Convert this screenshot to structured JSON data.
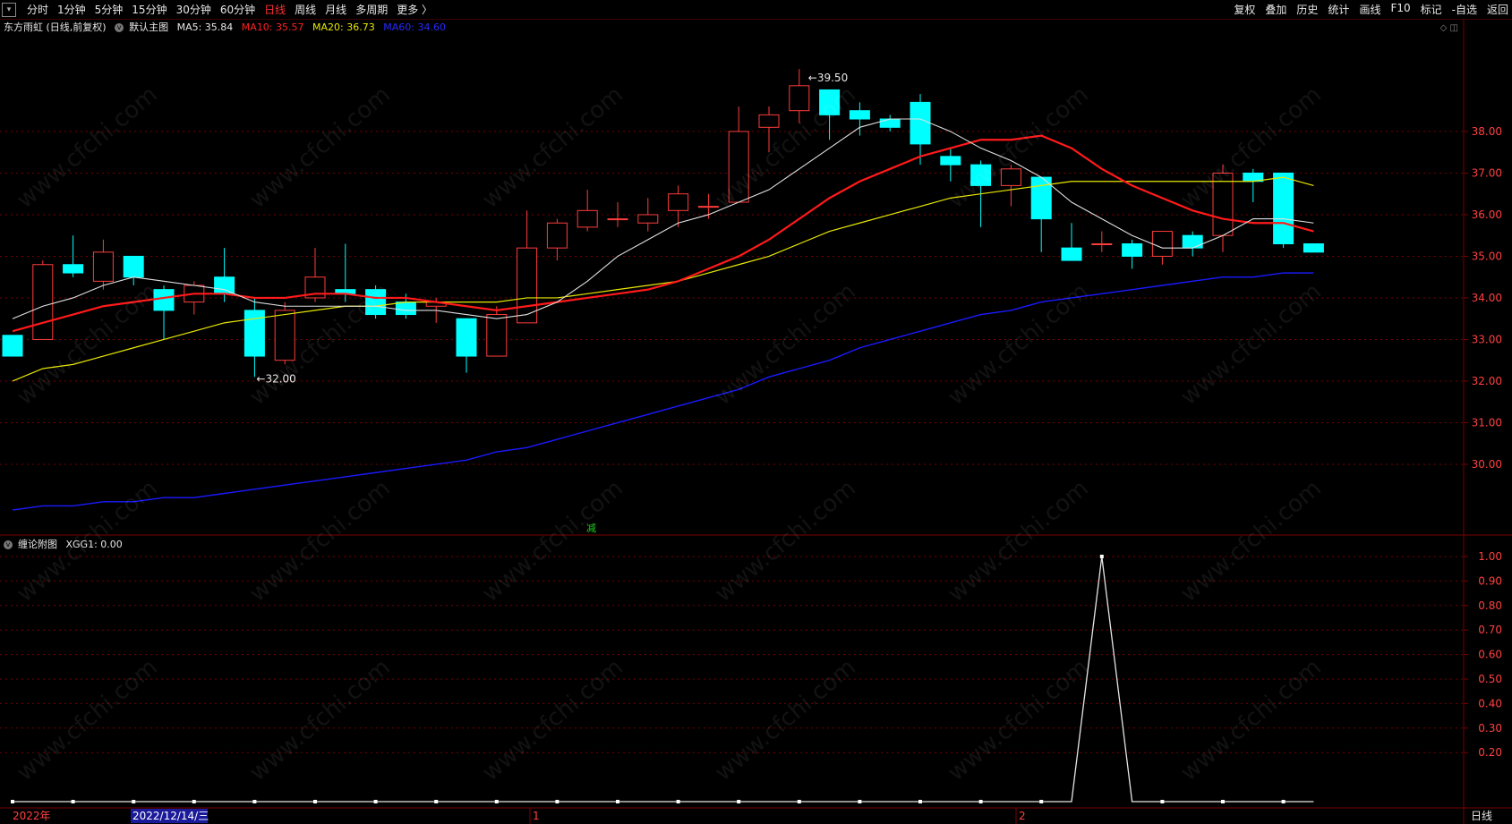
{
  "toolbar": {
    "periods": [
      "分时",
      "1分钟",
      "5分钟",
      "15分钟",
      "30分钟",
      "60分钟",
      "日线",
      "周线",
      "月线",
      "多周期",
      "更多 〉"
    ],
    "active_period": "日线",
    "right_buttons": [
      "复权",
      "叠加",
      "历史",
      "统计",
      "画线",
      "F10",
      "标记",
      "-自选",
      "返回"
    ]
  },
  "info": {
    "stock": "东方雨虹 (日线,前复权)",
    "indicator": "默认主图",
    "ma5": "MA5: 35.84",
    "ma10": "MA10: 35.57",
    "ma20": "MA20: 36.73",
    "ma60": "MA60: 34.60"
  },
  "sub_info": {
    "indicator": "缠论附图",
    "value": "XGG1: 0.00"
  },
  "colors": {
    "up": "#ff3c3c",
    "down": "#00ffff",
    "ma5": "#e0e0e0",
    "ma10": "#ff1a1a",
    "ma20": "#e8e800",
    "ma60": "#1a1aff",
    "grid": "#7a0000",
    "axis_text": "#ff4040"
  },
  "chart_data": [
    {
      "type": "candlestick",
      "y_ticks": [
        "38.00",
        "37.00",
        "36.00",
        "35.00",
        "34.00",
        "33.00",
        "32.00",
        "31.00",
        "30.00"
      ],
      "ylim": [
        28.3,
        40.3
      ],
      "annotations": {
        "high_label": "39.50",
        "low_label": "32.00",
        "marker": "减"
      },
      "x_labels": [
        "2022年",
        "2022/12/14/三",
        "1",
        "2"
      ],
      "bottom_right_label": "日线",
      "candles": [
        {
          "o": 33.1,
          "c": 32.6,
          "h": 33.1,
          "l": 32.6
        },
        {
          "o": 33.0,
          "c": 34.8,
          "h": 34.9,
          "l": 33.0
        },
        {
          "o": 34.8,
          "c": 34.6,
          "h": 35.5,
          "l": 34.5
        },
        {
          "o": 34.4,
          "c": 35.1,
          "h": 35.4,
          "l": 34.2
        },
        {
          "o": 35.0,
          "c": 34.5,
          "h": 35.0,
          "l": 34.3
        },
        {
          "o": 34.2,
          "c": 33.7,
          "h": 34.3,
          "l": 33.0
        },
        {
          "o": 33.9,
          "c": 34.3,
          "h": 34.4,
          "l": 33.6
        },
        {
          "o": 34.5,
          "c": 34.1,
          "h": 35.2,
          "l": 33.9
        },
        {
          "o": 33.7,
          "c": 32.6,
          "h": 34.0,
          "l": 32.1
        },
        {
          "o": 32.5,
          "c": 33.7,
          "h": 33.9,
          "l": 32.4
        },
        {
          "o": 34.0,
          "c": 34.5,
          "h": 35.2,
          "l": 33.9
        },
        {
          "o": 34.2,
          "c": 34.1,
          "h": 35.3,
          "l": 33.9
        },
        {
          "o": 34.2,
          "c": 33.6,
          "h": 34.3,
          "l": 33.5
        },
        {
          "o": 33.9,
          "c": 33.6,
          "h": 34.1,
          "l": 33.5
        },
        {
          "o": 33.8,
          "c": 33.9,
          "h": 34.0,
          "l": 33.4
        },
        {
          "o": 33.5,
          "c": 32.6,
          "h": 33.5,
          "l": 32.2
        },
        {
          "o": 32.6,
          "c": 33.6,
          "h": 33.8,
          "l": 32.6
        },
        {
          "o": 33.4,
          "c": 35.2,
          "h": 36.1,
          "l": 33.4
        },
        {
          "o": 35.2,
          "c": 35.8,
          "h": 35.9,
          "l": 34.9
        },
        {
          "o": 35.7,
          "c": 36.1,
          "h": 36.6,
          "l": 35.6
        },
        {
          "o": 35.9,
          "c": 35.9,
          "h": 36.3,
          "l": 35.7
        },
        {
          "o": 35.8,
          "c": 36.0,
          "h": 36.4,
          "l": 35.6
        },
        {
          "o": 36.1,
          "c": 36.5,
          "h": 36.7,
          "l": 35.7
        },
        {
          "o": 36.2,
          "c": 36.2,
          "h": 36.5,
          "l": 35.9
        },
        {
          "o": 36.3,
          "c": 38.0,
          "h": 38.6,
          "l": 36.3
        },
        {
          "o": 38.1,
          "c": 38.4,
          "h": 38.6,
          "l": 37.5
        },
        {
          "o": 38.5,
          "c": 39.1,
          "h": 39.5,
          "l": 38.2
        },
        {
          "o": 39.0,
          "c": 38.4,
          "h": 39.0,
          "l": 37.8
        },
        {
          "o": 38.5,
          "c": 38.3,
          "h": 38.7,
          "l": 37.9
        },
        {
          "o": 38.3,
          "c": 38.1,
          "h": 38.4,
          "l": 38.0
        },
        {
          "o": 38.7,
          "c": 37.7,
          "h": 38.9,
          "l": 37.2
        },
        {
          "o": 37.4,
          "c": 37.2,
          "h": 37.6,
          "l": 36.8
        },
        {
          "o": 37.2,
          "c": 36.7,
          "h": 37.3,
          "l": 35.7
        },
        {
          "o": 36.7,
          "c": 37.1,
          "h": 37.2,
          "l": 36.2
        },
        {
          "o": 36.9,
          "c": 35.9,
          "h": 36.9,
          "l": 35.1
        },
        {
          "o": 35.2,
          "c": 34.9,
          "h": 35.8,
          "l": 34.9
        },
        {
          "o": 35.3,
          "c": 35.3,
          "h": 35.6,
          "l": 35.1
        },
        {
          "o": 35.3,
          "c": 35.0,
          "h": 35.4,
          "l": 34.7
        },
        {
          "o": 35.0,
          "c": 35.6,
          "h": 35.6,
          "l": 34.8
        },
        {
          "o": 35.5,
          "c": 35.2,
          "h": 35.6,
          "l": 35.0
        },
        {
          "o": 35.5,
          "c": 37.0,
          "h": 37.2,
          "l": 35.1
        },
        {
          "o": 37.0,
          "c": 36.8,
          "h": 37.1,
          "l": 36.3
        },
        {
          "o": 37.0,
          "c": 35.3,
          "h": 37.0,
          "l": 35.2
        },
        {
          "o": 35.3,
          "c": 35.1,
          "h": 35.3,
          "l": 35.1
        }
      ],
      "ma5": [
        33.5,
        33.8,
        34.0,
        34.3,
        34.5,
        34.4,
        34.3,
        34.2,
        33.9,
        33.8,
        33.8,
        33.8,
        33.8,
        33.7,
        33.7,
        33.6,
        33.5,
        33.6,
        33.9,
        34.4,
        35.0,
        35.4,
        35.8,
        36.0,
        36.3,
        36.6,
        37.1,
        37.6,
        38.1,
        38.3,
        38.3,
        38.0,
        37.6,
        37.3,
        36.9,
        36.3,
        35.9,
        35.5,
        35.2,
        35.2,
        35.5,
        35.9,
        35.9,
        35.8
      ],
      "ma10": [
        33.2,
        33.4,
        33.6,
        33.8,
        33.9,
        34.0,
        34.1,
        34.1,
        34.0,
        34.0,
        34.1,
        34.1,
        34.0,
        34.0,
        33.9,
        33.8,
        33.7,
        33.8,
        33.9,
        34.0,
        34.1,
        34.2,
        34.4,
        34.7,
        35.0,
        35.4,
        35.9,
        36.4,
        36.8,
        37.1,
        37.4,
        37.6,
        37.8,
        37.8,
        37.9,
        37.6,
        37.1,
        36.7,
        36.4,
        36.1,
        35.9,
        35.8,
        35.8,
        35.6
      ],
      "ma20": [
        32.0,
        32.3,
        32.4,
        32.6,
        32.8,
        33.0,
        33.2,
        33.4,
        33.5,
        33.6,
        33.7,
        33.8,
        33.8,
        33.9,
        33.9,
        33.9,
        33.9,
        34.0,
        34.0,
        34.1,
        34.2,
        34.3,
        34.4,
        34.6,
        34.8,
        35.0,
        35.3,
        35.6,
        35.8,
        36.0,
        36.2,
        36.4,
        36.5,
        36.6,
        36.7,
        36.8,
        36.8,
        36.8,
        36.8,
        36.8,
        36.8,
        36.8,
        36.9,
        36.7
      ],
      "ma60": [
        28.9,
        29.0,
        29.0,
        29.1,
        29.1,
        29.2,
        29.2,
        29.3,
        29.4,
        29.5,
        29.6,
        29.7,
        29.8,
        29.9,
        30.0,
        30.1,
        30.3,
        30.4,
        30.6,
        30.8,
        31.0,
        31.2,
        31.4,
        31.6,
        31.8,
        32.1,
        32.3,
        32.5,
        32.8,
        33.0,
        33.2,
        33.4,
        33.6,
        33.7,
        33.9,
        34.0,
        34.1,
        34.2,
        34.3,
        34.4,
        34.5,
        34.5,
        34.6,
        34.6
      ]
    },
    {
      "type": "line",
      "name": "XGG1",
      "y_ticks": [
        "1.00",
        "0.90",
        "0.80",
        "0.70",
        "0.60",
        "0.50",
        "0.40",
        "0.30",
        "0.20"
      ],
      "ylim": [
        0,
        1.0
      ],
      "values": [
        0,
        0,
        0,
        0,
        0,
        0,
        0,
        0,
        0,
        0,
        0,
        0,
        0,
        0,
        0,
        0,
        0,
        0,
        0,
        0,
        0,
        0,
        0,
        0,
        0,
        0,
        0,
        0,
        0,
        0,
        0,
        0,
        0,
        0,
        0,
        0,
        1,
        0,
        0,
        0,
        0,
        0,
        0,
        0
      ],
      "dot_every": 2
    }
  ]
}
